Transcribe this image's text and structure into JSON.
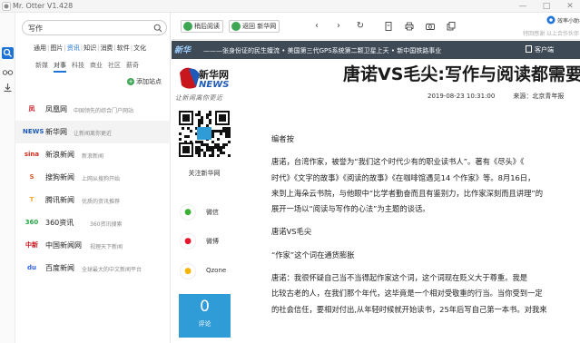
{
  "window": {
    "title": "Mr. Otter V1.428",
    "controls": [
      "minimize",
      "maximize",
      "close"
    ]
  },
  "iconstrip": {
    "items": [
      {
        "icon": "search-icon"
      },
      {
        "icon": "glasses-icon"
      },
      {
        "icon": "download-icon"
      }
    ]
  },
  "search": {
    "value": "写作",
    "placeholder": ""
  },
  "categories": {
    "items": [
      "通用",
      "图片",
      "资讯",
      "知识",
      "消费",
      "软件",
      "文化"
    ],
    "active": "资讯",
    "sub_items": [
      "新媒",
      "对事",
      "科技",
      "商业",
      "社区",
      "薪奇"
    ],
    "sub_active": "对事"
  },
  "add_site_label": "添加站点",
  "sites": [
    {
      "name": "凤凰网",
      "desc": "中国领先的综合门户网站",
      "logo_text": "凤",
      "logo_color": "#c8161d"
    },
    {
      "name": "新华网",
      "desc": "让新闻离你更近",
      "logo_text": "NEWS",
      "logo_color": "#1e5bb8"
    },
    {
      "name": "新浪新闻",
      "desc": "新浪新闻",
      "logo_text": "sina",
      "logo_color": "#d52b1e"
    },
    {
      "name": "搜狗新闻",
      "desc": "上网从搜狗开始",
      "logo_text": "S",
      "logo_color": "#e05a2b"
    },
    {
      "name": "腾讯新闻",
      "desc": "优质的资讯推荐",
      "logo_text": "T",
      "logo_color": "#f5a623"
    },
    {
      "name": "360资讯",
      "desc": "360资讯搜索",
      "logo_text": "360",
      "logo_color": "#28a745"
    },
    {
      "name": "中国新闻网",
      "desc": "视理天下新闻",
      "logo_text": "中新",
      "logo_color": "#c8161d"
    },
    {
      "name": "百度新闻",
      "desc": "全球最大的中文新闻平台",
      "logo_text": "du",
      "logo_color": "#2e61e8"
    }
  ],
  "toolbar": {
    "back_button": "稍后阅读",
    "home_button": "返回 新华网",
    "nav_icons": [
      "chevron-left-icon",
      "chevron-right-icon",
      "refresh-icon",
      "document-icon",
      "print-icon",
      "camera-icon",
      "duplicate-icon"
    ],
    "app_badge": "效率小助手",
    "app_badge_sub": "特回感谢 以上合作伙伴"
  },
  "webpage": {
    "ticker_brand": "新华",
    "ticker_text": "———张身份证的民生嬗流   • 美国第三代GPS系统第二颗卫星上天   • 新中国铁路事业",
    "client_label": "客户端",
    "logo_text": "新华网",
    "logo_sub": "NEWS",
    "slogan": "让新闻离你更近",
    "article_title": "唐诺VS毛尖:写作与阅读都需要",
    "date": "2019-08-23 10:31:00",
    "source": "来源：北京青年报",
    "qr_caption": "关注新华网",
    "share": [
      {
        "label": "微信",
        "icon": "wechat-icon",
        "color": "#3cb034"
      },
      {
        "label": "微博",
        "icon": "weibo-icon",
        "color": "#e6162d"
      },
      {
        "label": "Qzone",
        "icon": "qzone-icon",
        "color": "#f5b400"
      }
    ],
    "comment_count": "0",
    "comment_label": "评论",
    "paragraphs": [
      "编者按",
      "唐诺，台湾作家，被誉为“我们这个时代少有的职业读书人”。著有《尽头》《",
      "时代》《文字的故事》《阅读的故事》《在咖啡馆遇见14 个作家》等。8月16日，",
      "来到上海朵云书院，与他眼中“比学者勤奋而且有鉴别力，比作家深刻而且讲理”的",
      "展开一场以“阅读与写作的心法”为主题的谈话。",
      "唐诺VS毛尖",
      "“作家”这个词在通货膨胀",
      "唐诺：我很怀疑自己当不当得起作家这个词，这个词现在贬义大于尊重。我是",
      "比较古老的人，在我们那个年代，这毕竟是一个相对受敬重的行当。当你受到一定",
      "的社会信任，要相对付出,从年轻时候就开始读书，25年后写自己第一本书。对我来"
    ]
  }
}
